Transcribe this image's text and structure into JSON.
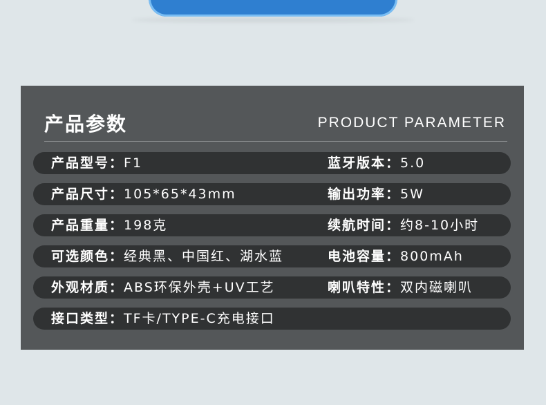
{
  "header": {
    "title_cn": "产品参数",
    "title_en": "PRODUCT PARAMETER"
  },
  "colors": {
    "panel_bg": "#545759",
    "row_bg": "#303233",
    "page_bg": "#dfe6e9",
    "product_blue": "#2f7fd0"
  },
  "rows": [
    {
      "left": {
        "label": "产品型号：",
        "value": "F1"
      },
      "right": {
        "label": "蓝牙版本：",
        "value": "5.0"
      }
    },
    {
      "left": {
        "label": "产品尺寸：",
        "value": "105*65*43mm"
      },
      "right": {
        "label": "输出功率：",
        "value": "5W"
      }
    },
    {
      "left": {
        "label": "产品重量：",
        "value": "198克"
      },
      "right": {
        "label": "续航时间：",
        "value": "约8-10小时"
      }
    },
    {
      "left": {
        "label": "可选颜色：",
        "value": "经典黑、中国红、湖水蓝"
      },
      "right": {
        "label": "电池容量：",
        "value": "800mAh"
      }
    },
    {
      "left": {
        "label": "外观材质：",
        "value": "ABS环保外壳+UV工艺"
      },
      "right": {
        "label": "喇叭特性：",
        "value": "双内磁喇叭"
      }
    },
    {
      "left": {
        "label": "接口类型：",
        "value": "TF卡/TYPE-C充电接口"
      }
    }
  ]
}
